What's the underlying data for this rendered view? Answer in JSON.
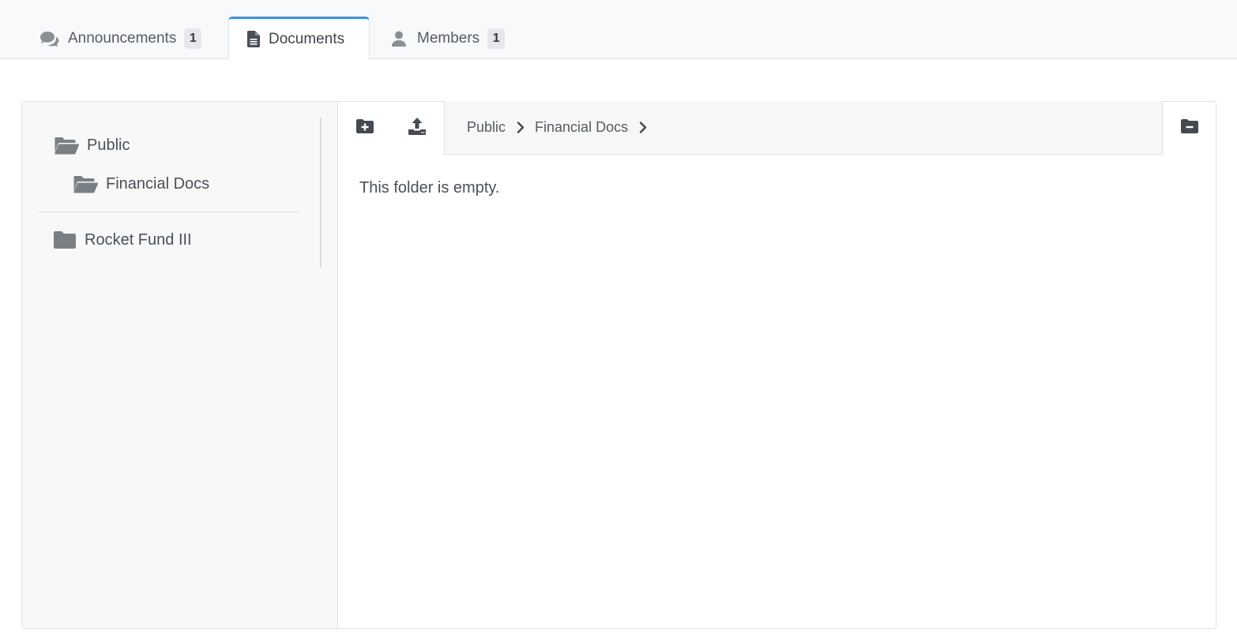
{
  "tabs": [
    {
      "label": "Announcements",
      "badge": "1",
      "icon": "comments-icon"
    },
    {
      "label": "Documents",
      "icon": "file-text-icon",
      "active": true
    },
    {
      "label": "Members",
      "badge": "1",
      "icon": "user-icon"
    }
  ],
  "tree": {
    "items": [
      {
        "label": "Public",
        "icon": "folder-open-icon"
      },
      {
        "label": "Financial Docs",
        "icon": "folder-open-icon"
      },
      {
        "label": "Rocket Fund III",
        "icon": "folder-icon"
      }
    ]
  },
  "toolbar": {
    "new_folder_icon": "folder-plus-icon",
    "upload_icon": "upload-icon",
    "remove_folder_icon": "folder-minus-icon"
  },
  "breadcrumb": [
    "Public",
    "Financial Docs"
  ],
  "content": {
    "empty_message": "This folder is empty."
  },
  "colors": {
    "accent": "#3a91e0",
    "icon": "#555b61",
    "folder": "#7a7f84"
  }
}
